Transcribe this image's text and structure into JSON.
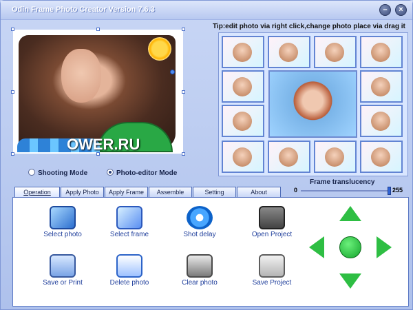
{
  "window": {
    "title": "Odin Frame Photo Creator Version 7.6.3",
    "controls": [
      "–",
      "×"
    ]
  },
  "preview": {
    "watermark": "OWER.RU"
  },
  "modes": [
    {
      "label": "Shooting Mode",
      "selected": false
    },
    {
      "label": "Photo-editor Mode",
      "selected": true
    }
  ],
  "tip": "Tip:edit photo via right click,change photo place via drag it",
  "frame_translucency": {
    "label": "Frame translucency",
    "min": "0",
    "max": "255",
    "value_fraction": 0.97
  },
  "tabs": [
    "Operation",
    "Apply Photo",
    "Apply Frame",
    "Assemble photo",
    "Setting",
    "About"
  ],
  "actions": [
    {
      "label": "Select photo",
      "icon": "photo-icon"
    },
    {
      "label": "Select frame",
      "icon": "frame-icon"
    },
    {
      "label": "Shot delay",
      "icon": "compass-icon"
    },
    {
      "label": "Open Project",
      "icon": "camera-icon"
    },
    {
      "label": "Save or Print",
      "icon": "printer-icon"
    },
    {
      "label": "Delete photo",
      "icon": "delete-icon"
    },
    {
      "label": "Clear photo",
      "icon": "trash-icon"
    },
    {
      "label": "Save Project",
      "icon": "project-icon"
    }
  ]
}
